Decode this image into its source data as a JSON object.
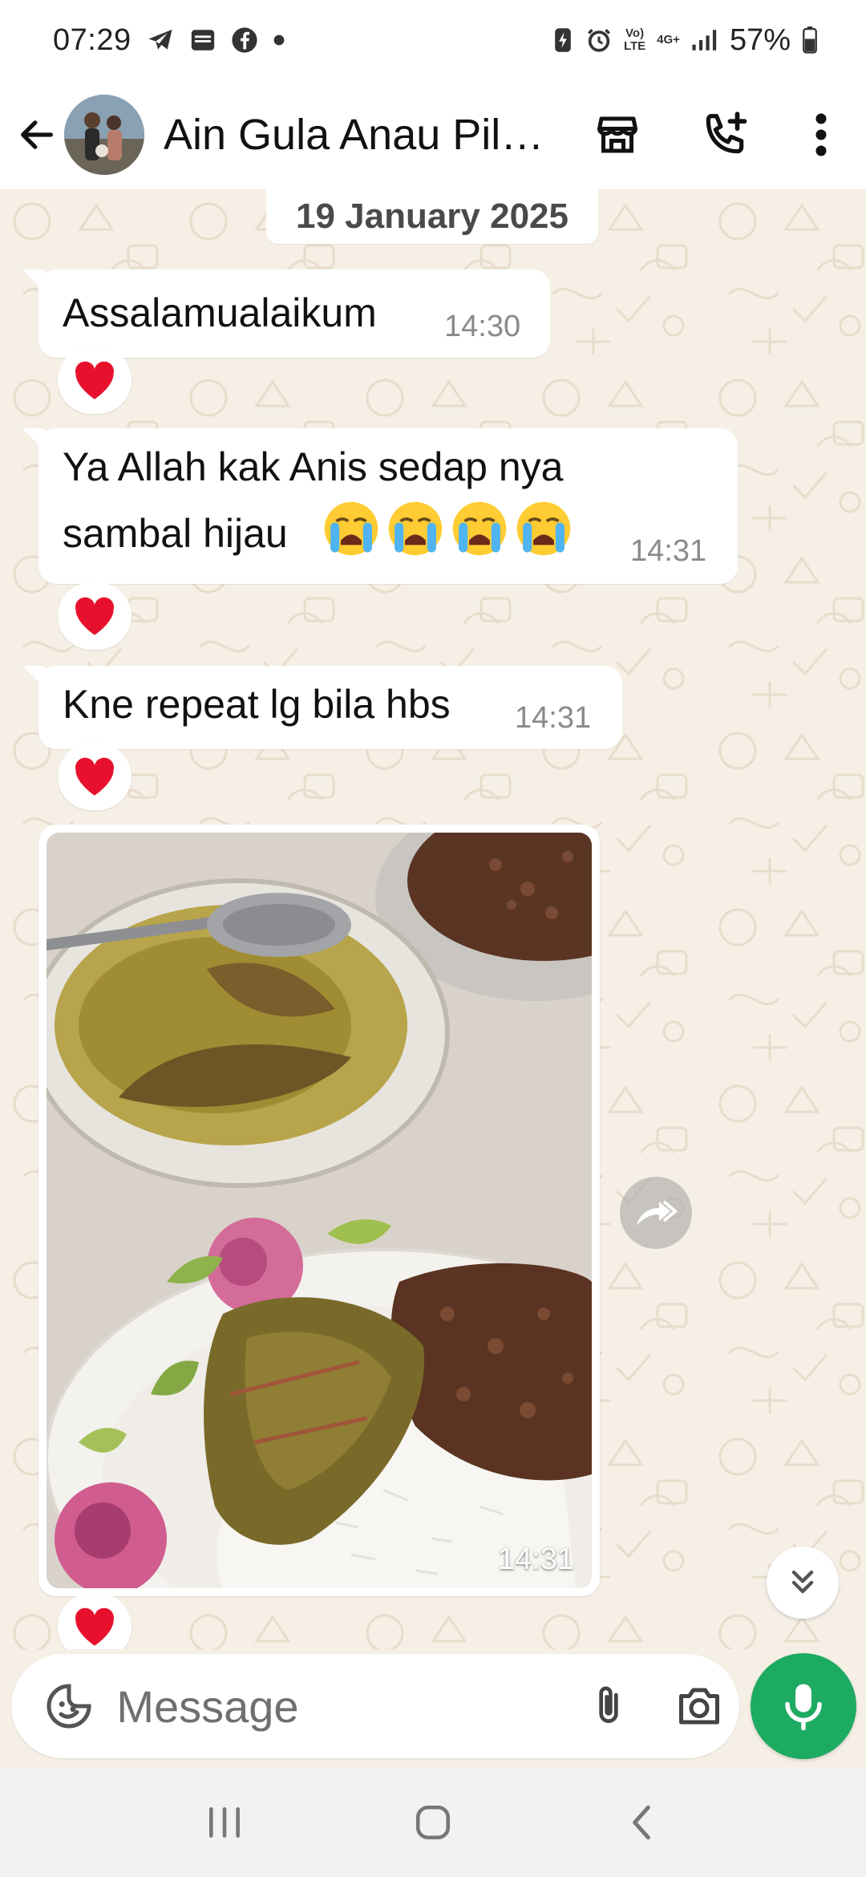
{
  "status_bar": {
    "time": "07:29",
    "battery_percent": "57%",
    "network_top": "4G+",
    "volte_label": "Vo)) LTE",
    "left_icons": [
      "telegram-icon",
      "news-icon",
      "facebook-icon",
      "dot-icon"
    ],
    "right_icons": [
      "battery-saver-icon",
      "alarm-icon",
      "volte-icon",
      "network-icon",
      "signal-icon",
      "battery-icon"
    ]
  },
  "header": {
    "back_icon": "arrow-left-icon",
    "contact_name": "Ain Gula Anau Pilot Hantar...",
    "actions": [
      "shop-icon",
      "add-call-icon",
      "more-vertical-icon"
    ]
  },
  "chat": {
    "date_chip": "19 January 2025",
    "messages": [
      {
        "text": "Assalamualaikum",
        "time": "14:30",
        "reaction": "❤️"
      },
      {
        "text_line1": "Ya Allah kak Anis sedap nya",
        "text_line2": "sambal hijau",
        "emoji": [
          "crying-face-emoji",
          "crying-face-emoji",
          "crying-face-emoji",
          "crying-face-emoji"
        ],
        "time": "14:31",
        "reaction": "❤️"
      },
      {
        "text": "Kne repeat lg bila hbs",
        "time": "14:31",
        "reaction": "❤️"
      },
      {
        "type": "image",
        "description_icon": "food-photo",
        "time": "14:31",
        "reaction": "❤️"
      }
    ],
    "forward_icon": "forward-icon",
    "scroll_down_icon": "double-chevron-down-icon"
  },
  "composer": {
    "placeholder": "Message",
    "value": "",
    "icons": [
      "sticker-icon",
      "attach-icon",
      "camera-icon"
    ],
    "mic_icon": "mic-icon"
  },
  "colors": {
    "accent_green": "#1daa61",
    "chat_background": "#f5efe6",
    "bubble": "#ffffff"
  },
  "nav_bar": {
    "buttons": [
      "recents-icon",
      "home-icon",
      "back-icon"
    ]
  }
}
